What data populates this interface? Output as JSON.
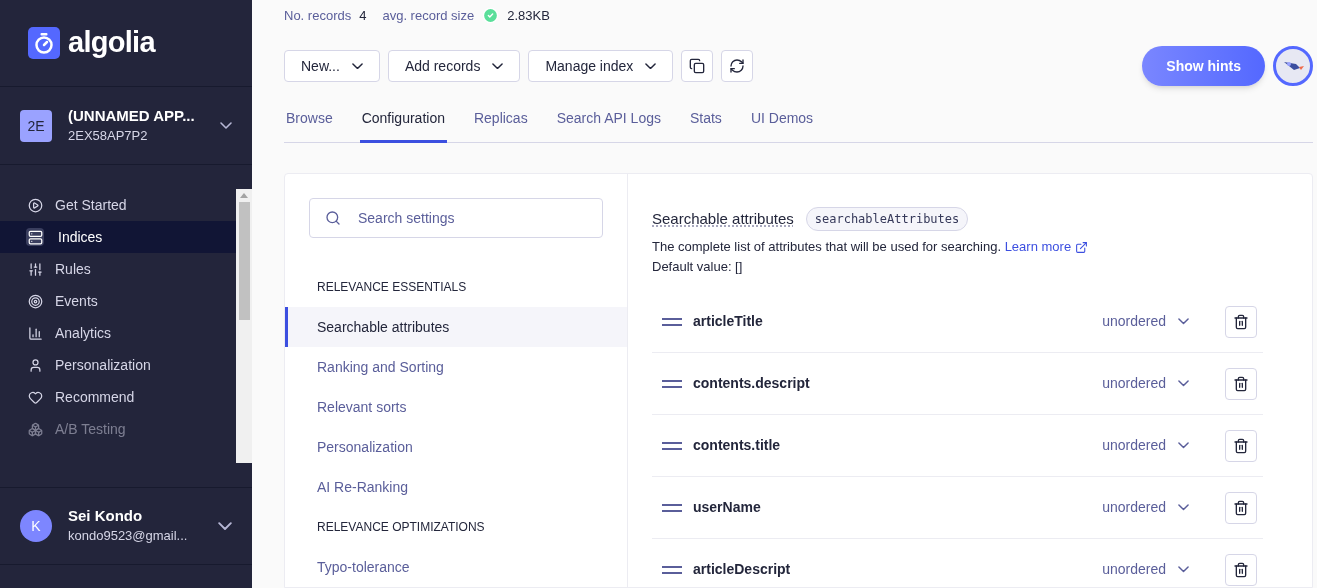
{
  "sidebar": {
    "logo": "algolia",
    "app": {
      "initials": "2E",
      "name": "(UNNAMED APP...",
      "id": "2EX58AP7P2"
    },
    "nav": [
      {
        "label": "Get Started",
        "selected": false
      },
      {
        "label": "Indices",
        "selected": true
      },
      {
        "label": "Rules",
        "selected": false
      },
      {
        "label": "Events",
        "selected": false
      },
      {
        "label": "Analytics",
        "selected": false
      },
      {
        "label": "Personalization",
        "selected": false
      },
      {
        "label": "Recommend",
        "selected": false
      },
      {
        "label": "A/B Testing",
        "selected": false
      }
    ],
    "user": {
      "initial": "K",
      "name": "Sei Kondo",
      "email": "kondo9523@gmail..."
    }
  },
  "stats": [
    {
      "label": "No. records",
      "value": "4",
      "ok": false
    },
    {
      "label": "avg. record size",
      "value": "2.83KB",
      "ok": true
    }
  ],
  "toolbar": {
    "menus": [
      {
        "label": "New..."
      },
      {
        "label": "Add records"
      },
      {
        "label": "Manage index"
      }
    ],
    "hints_button": "Show hints"
  },
  "tabs": [
    {
      "label": "Browse",
      "selected": false
    },
    {
      "label": "Configuration",
      "selected": true
    },
    {
      "label": "Replicas",
      "selected": false
    },
    {
      "label": "Search API Logs",
      "selected": false
    },
    {
      "label": "Stats",
      "selected": false
    },
    {
      "label": "UI Demos",
      "selected": false
    }
  ],
  "settings": {
    "search": {
      "placeholder": "Search settings"
    },
    "sections": [
      {
        "heading": "RELEVANCE ESSENTIALS",
        "items": [
          {
            "label": "Searchable attributes",
            "selected": true
          },
          {
            "label": "Ranking and Sorting",
            "selected": false
          },
          {
            "label": "Relevant sorts",
            "selected": false
          },
          {
            "label": "Personalization",
            "selected": false
          },
          {
            "label": "AI Re-Ranking",
            "selected": false
          }
        ]
      },
      {
        "heading": "RELEVANCE OPTIMIZATIONS",
        "items": [
          {
            "label": "Typo-tolerance",
            "selected": false
          }
        ]
      }
    ]
  },
  "detail": {
    "title": "Searchable attributes",
    "code": "searchableAttributes",
    "description": "The complete list of attributes that will be used for searching.",
    "link": "Learn more",
    "default": "Default value: []",
    "attributes": [
      {
        "name": "articleTitle",
        "order": "unordered"
      },
      {
        "name": "contents.descript",
        "order": "unordered"
      },
      {
        "name": "contents.title",
        "order": "unordered"
      },
      {
        "name": "userName",
        "order": "unordered"
      },
      {
        "name": "articleDescript",
        "order": "unordered"
      }
    ]
  }
}
